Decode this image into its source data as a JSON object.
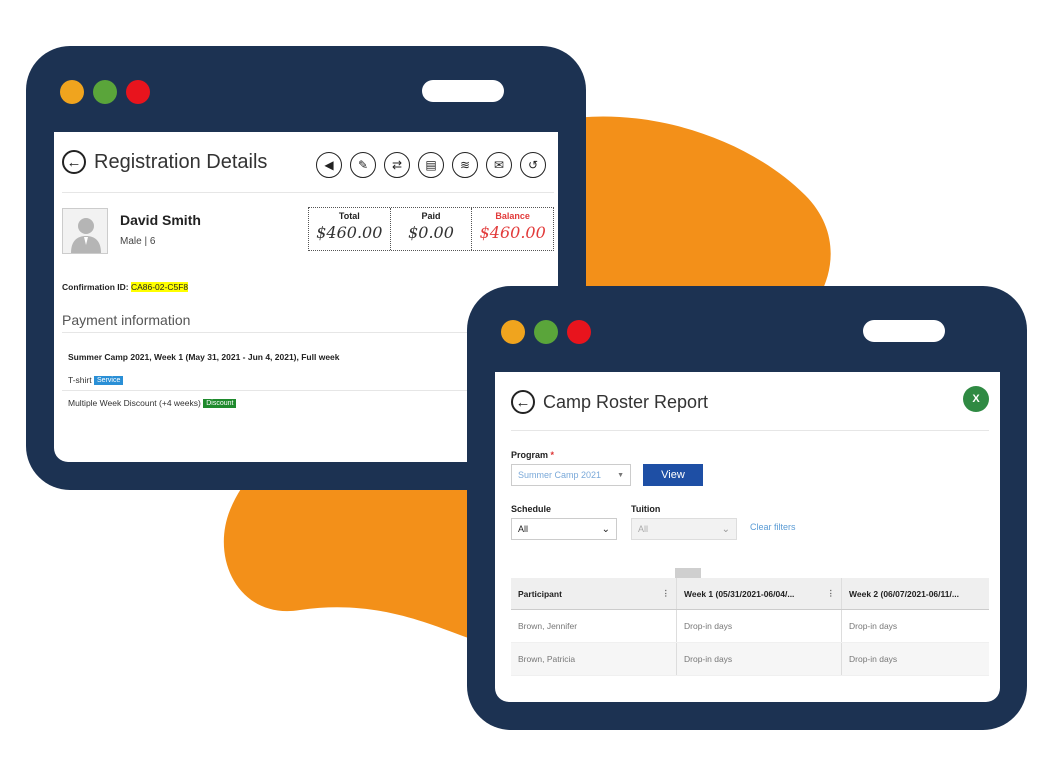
{
  "registration": {
    "title": "Registration Details",
    "toolbar": [
      "back-circle",
      "pencil",
      "swap",
      "document",
      "coins",
      "envelope",
      "history"
    ],
    "person": {
      "name": "David Smith",
      "meta": "Male | 6"
    },
    "totals": [
      {
        "label": "Total",
        "value": "$460.00"
      },
      {
        "label": "Paid",
        "value": "$0.00"
      },
      {
        "label": "Balance",
        "value": "$460.00"
      }
    ],
    "confirmation_label": "Confirmation ID:",
    "confirmation_id": "CA86-02-C5F8",
    "payment_heading": "Payment information",
    "camp_line": "Summer Camp 2021, Week 1 (May 31, 2021 - Jun 4, 2021), Full week",
    "items": [
      {
        "text": "T-shirt",
        "badge": "Service"
      },
      {
        "text": "Multiple Week Discount (+4 weeks)",
        "badge": "Discount"
      }
    ]
  },
  "report": {
    "title": "Camp Roster Report",
    "program_label": "Program",
    "program_required": "*",
    "program_value": "Summer Camp 2021",
    "view_label": "View",
    "schedule_label": "Schedule",
    "schedule_value": "All",
    "tuition_label": "Tuition",
    "tuition_value": "All",
    "clear_filters": "Clear filters",
    "columns": [
      "Participant",
      "Week 1 (05/31/2021-06/04/...",
      "Week 2 (06/07/2021-06/11/..."
    ],
    "rows": [
      [
        "Brown, Jennifer",
        "Drop-in days",
        "Drop-in days"
      ],
      [
        "Brown, Patricia",
        "Drop-in days",
        "Drop-in days"
      ]
    ]
  },
  "colors": {
    "frame": "#1c3252",
    "blob": "#f39019",
    "balance": "#e23b3b",
    "view_button": "#1e4fa5"
  }
}
